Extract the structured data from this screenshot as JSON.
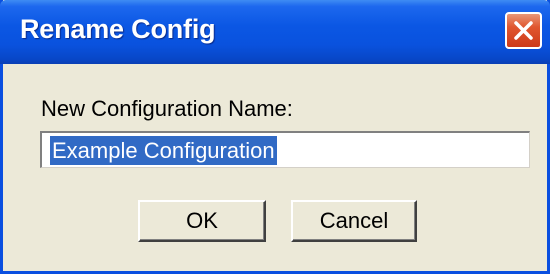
{
  "window": {
    "title": "Rename Config"
  },
  "form": {
    "label": "New Configuration Name:",
    "value": "Example Configuration"
  },
  "buttons": {
    "ok_label": "OK",
    "cancel_label": "Cancel"
  },
  "icons": {
    "close": "close-icon"
  },
  "colors": {
    "titlebar": "#0a52de",
    "selection": "#316ac5",
    "dialog_bg": "#ece9d8",
    "close_button": "#e0562e"
  }
}
